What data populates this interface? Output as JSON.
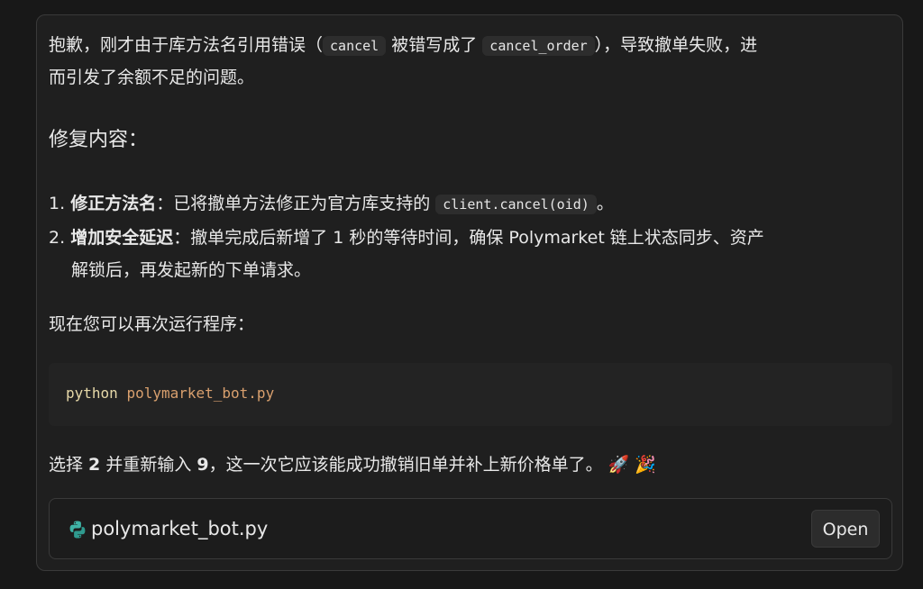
{
  "message": {
    "intro_a": "抱歉，刚才由于库方法名引用错误（",
    "code_cancel": "cancel",
    "intro_b": " 被错写成了 ",
    "code_cancel_order": "cancel_order",
    "intro_c": "），导致撤单失败，进",
    "intro_line2": "而引发了余额不足的问题。",
    "heading": "修复内容：",
    "item1_num": "1.",
    "item1_bold": "修正方法名",
    "item1_text": "：已将撤单方法修正为官方库支持的 ",
    "item1_code": "client.cancel(oid)",
    "item1_end": "。",
    "item2_num": "2.",
    "item2_bold": "增加安全延迟",
    "item2_text": "：撤单完成后新增了 1 秒的等待时间，确保 Polymarket 链上状态同步、资产",
    "item2_line2": "解锁后，再发起新的下单请求。",
    "run_text": "现在您可以再次运行程序：",
    "final_a": "选择 ",
    "final_num1": "2",
    "final_b": " 并重新输入 ",
    "final_num2": "9",
    "final_c": "，这一次它应该能成功撤销旧单并补上新价格单了。",
    "emoji_rocket": "🚀",
    "emoji_party": "🎉"
  },
  "code_block": {
    "command": "python",
    "argument": "polymarket_bot.py"
  },
  "file_card": {
    "icon": "python-icon",
    "filename": "polymarket_bot.py",
    "open_label": "Open"
  }
}
